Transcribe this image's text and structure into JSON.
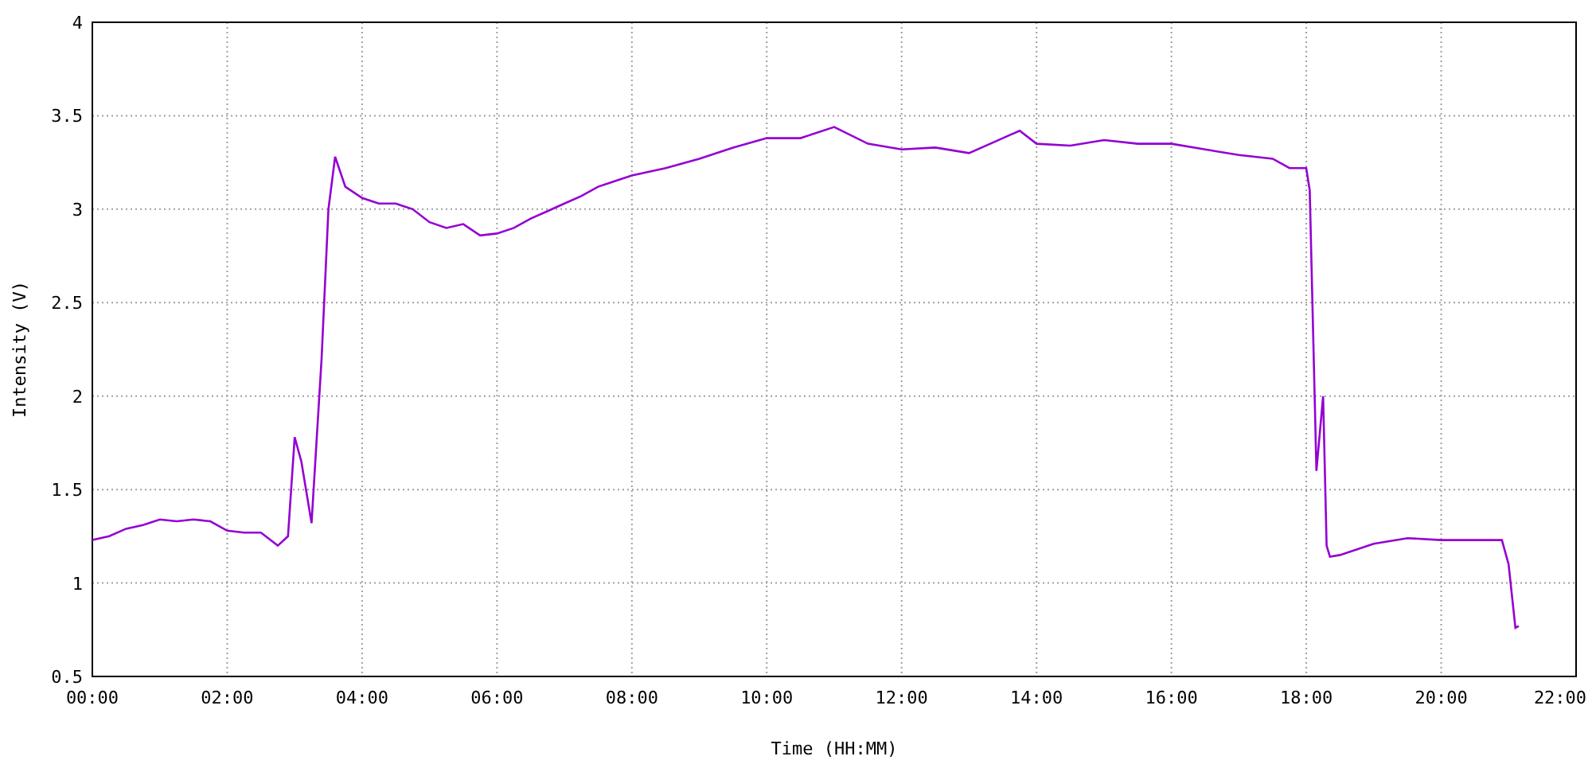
{
  "chart": {
    "chart_data": {
      "type": "line",
      "grid": true,
      "xlabel": "Time (HH:MM)",
      "ylabel": "Intensity (V)",
      "xlim": [
        0,
        22
      ],
      "ylim": [
        0.5,
        4
      ],
      "xticks": [
        {
          "value": 0,
          "label": "00:00"
        },
        {
          "value": 2,
          "label": "02:00"
        },
        {
          "value": 4,
          "label": "04:00"
        },
        {
          "value": 6,
          "label": "06:00"
        },
        {
          "value": 8,
          "label": "08:00"
        },
        {
          "value": 10,
          "label": "10:00"
        },
        {
          "value": 12,
          "label": "12:00"
        },
        {
          "value": 14,
          "label": "14:00"
        },
        {
          "value": 16,
          "label": "16:00"
        },
        {
          "value": 18,
          "label": "18:00"
        },
        {
          "value": 20,
          "label": "20:00"
        },
        {
          "value": 22,
          "label": "22:00"
        }
      ],
      "yticks": [
        0.5,
        1,
        1.5,
        2,
        2.5,
        3,
        3.5,
        4
      ],
      "x": [
        0,
        0.25,
        0.5,
        0.75,
        1,
        1.25,
        1.5,
        1.75,
        2,
        2.25,
        2.5,
        2.75,
        2.9,
        3,
        3.1,
        3.25,
        3.4,
        3.5,
        3.6,
        3.75,
        4,
        4.25,
        4.5,
        4.75,
        5,
        5.25,
        5.5,
        5.75,
        6,
        6.25,
        6.5,
        6.75,
        7,
        7.25,
        7.5,
        7.75,
        8,
        8.5,
        9,
        9.5,
        10,
        10.5,
        11,
        11.5,
        12,
        12.5,
        13,
        13.5,
        13.75,
        14,
        14.5,
        15,
        15.5,
        16,
        16.5,
        17,
        17.5,
        17.75,
        18,
        18.05,
        18.15,
        18.25,
        18.3,
        18.35,
        18.5,
        19,
        19.5,
        20,
        20.5,
        20.9,
        21,
        21.1,
        21.15
      ],
      "series": [
        {
          "color": "#9400d3",
          "values": [
            1.23,
            1.25,
            1.29,
            1.31,
            1.34,
            1.33,
            1.34,
            1.33,
            1.28,
            1.27,
            1.27,
            1.2,
            1.25,
            1.78,
            1.65,
            1.32,
            2.2,
            3.0,
            3.28,
            3.12,
            3.06,
            3.03,
            3.03,
            3.0,
            2.93,
            2.9,
            2.92,
            2.86,
            2.87,
            2.9,
            2.95,
            2.99,
            3.03,
            3.07,
            3.12,
            3.15,
            3.18,
            3.22,
            3.27,
            3.33,
            3.38,
            3.38,
            3.44,
            3.35,
            3.32,
            3.33,
            3.3,
            3.38,
            3.42,
            3.35,
            3.34,
            3.37,
            3.35,
            3.35,
            3.32,
            3.29,
            3.27,
            3.22,
            3.22,
            3.1,
            1.6,
            2.0,
            1.2,
            1.14,
            1.15,
            1.21,
            1.24,
            1.23,
            1.23,
            1.23,
            1.1,
            0.76,
            0.77
          ]
        }
      ]
    }
  }
}
